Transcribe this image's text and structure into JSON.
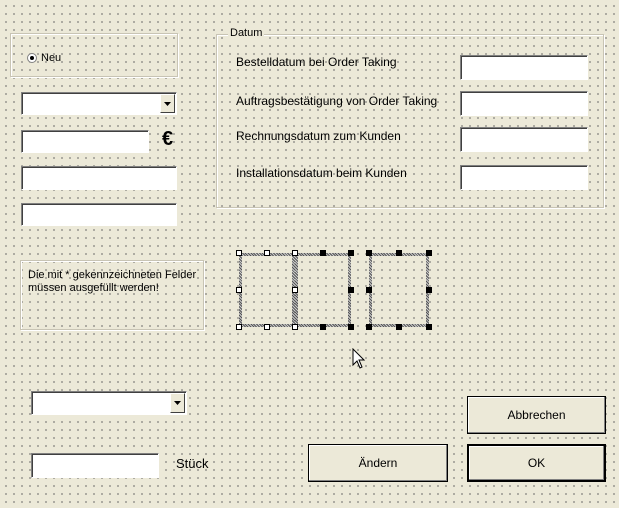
{
  "option_frame": {
    "radio_label": "Neu"
  },
  "currency_symbol": "€",
  "info_text": "Die mit * gekennzeichneten Felder müssen ausgefüllt werden!",
  "datum_frame": {
    "title": "Datum",
    "labels": [
      "Bestelldatum bei Order Taking",
      "Auftragsbestätigung von Order Taking",
      "Rechnungsdatum zum Kunden",
      "Installationsdatum beim Kunden"
    ]
  },
  "quantity_unit": "Stück",
  "buttons": {
    "change": "Ändern",
    "cancel": "Abbrechen",
    "ok": "OK"
  }
}
